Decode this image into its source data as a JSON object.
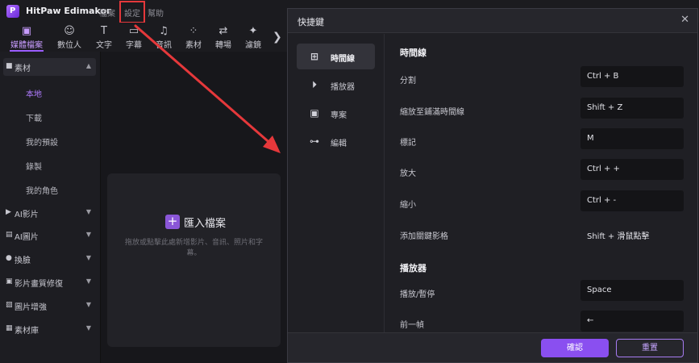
{
  "app": {
    "name": "HitPaw Edimakor",
    "menu": [
      "檔案",
      "設定",
      "幫助"
    ]
  },
  "toolbar": {
    "tabs": [
      {
        "label": "媒體檔案",
        "icon": "media-icon",
        "active": true
      },
      {
        "label": "數位人",
        "icon": "avatar-icon"
      },
      {
        "label": "文字",
        "icon": "text-icon"
      },
      {
        "label": "字幕",
        "icon": "subtitle-icon"
      },
      {
        "label": "音訊",
        "icon": "music-icon"
      },
      {
        "label": "素材",
        "icon": "elements-icon"
      },
      {
        "label": "轉場",
        "icon": "transition-icon"
      },
      {
        "label": "濾鏡",
        "icon": "filter-icon"
      }
    ]
  },
  "sidebar": {
    "material": {
      "label": "素材",
      "items": [
        "本地",
        "下載",
        "我的預設",
        "錄製",
        "我的角色"
      ],
      "active": "本地"
    },
    "sections": [
      "AI影片",
      "AI圖片",
      "換臉",
      "影片畫質修復",
      "圖片增強",
      "素材庫"
    ]
  },
  "import": {
    "label": "匯入檔案",
    "hint": "拖放或點擊此處新增影片、音訊、照片和字幕。"
  },
  "dialog": {
    "title": "快捷鍵",
    "nav": [
      {
        "label": "時間線",
        "active": true
      },
      {
        "label": "播放器"
      },
      {
        "label": "專案"
      },
      {
        "label": "編輯"
      }
    ],
    "groups": [
      {
        "title": "時間線",
        "rows": [
          {
            "label": "分割",
            "key": "Ctrl + B"
          },
          {
            "label": "縮放至鋪滿時間線",
            "key": "Shift + Z"
          },
          {
            "label": "標記",
            "key": "M"
          },
          {
            "label": "放大",
            "key": "Ctrl + +"
          },
          {
            "label": "縮小",
            "key": "Ctrl + -"
          },
          {
            "label": "添加關鍵影格",
            "key": "Shift + 滑鼠點擊"
          }
        ]
      },
      {
        "title": "播放器",
        "rows": [
          {
            "label": "播放/暫停",
            "key": "Space"
          },
          {
            "label": "前一幀",
            "key": "←"
          }
        ]
      }
    ],
    "confirm_label": "確認",
    "reset_label": "重置",
    "close_icon": "close-icon"
  },
  "colors": {
    "accent": "#8a4ff0",
    "annotation": "#e5383b"
  }
}
